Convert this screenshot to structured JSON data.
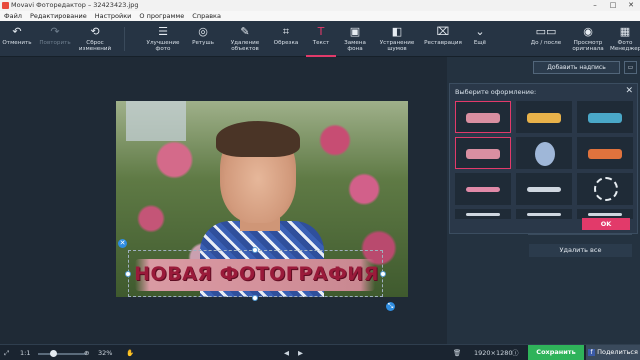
{
  "window": {
    "title": "Movavi Фоторедактор – 32423423.jpg"
  },
  "menu": [
    "Файл",
    "Редактирование",
    "Настройки",
    "О программе",
    "Справка"
  ],
  "toolbar": {
    "undo": "Отменить",
    "redo": "Повторить",
    "reset": "Сброс изменений",
    "enhance": "Улучшение фото",
    "retouch": "Ретушь",
    "remove_objects": "Удаление объектов",
    "crop": "Обрезка",
    "text": "Текст",
    "replace_bg": "Замена фона",
    "denoise": "Устранение шумов",
    "restore": "Реставрация",
    "more": "Ещё",
    "before_after": "До / после",
    "view_original": "Просмотр оригинала",
    "photo_manager": "Фото Менеджер"
  },
  "canvas": {
    "caption_text": "НОВАЯ ФОТОГРАФИЯ"
  },
  "right_panel": {
    "add_caption": "Добавить надпись",
    "popup_title": "Выберите оформление:",
    "ok": "OK",
    "delete_all": "Удалить все",
    "swatch_colors": [
      "#d98fa1",
      "#e8b24a",
      "#4aa8c8",
      "#d98fa1",
      "#9fb7d8",
      "#e0733d",
      "#e08aa8",
      "#cfd7e0",
      "#e8eef3",
      "#cfd7e0",
      "#cfd7e0",
      "#cfd7e0"
    ]
  },
  "bottom": {
    "fit": "1:1",
    "zoom": "32%",
    "dimensions": "1920×1280",
    "save": "Сохранить",
    "share": "Поделиться"
  },
  "colors": {
    "accent": "#e23a6a",
    "save": "#2fb35a",
    "selection": "#2f8de0"
  }
}
